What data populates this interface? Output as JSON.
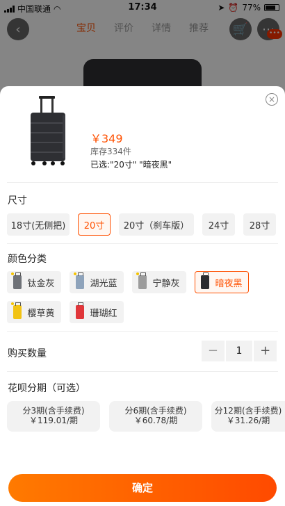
{
  "status": {
    "carrier": "中国联通",
    "time": "17:34",
    "battery": "77%",
    "battery_level": 0.77
  },
  "nav": {
    "tabs": [
      {
        "label": "宝贝",
        "active": true
      },
      {
        "label": "评价",
        "active": false
      },
      {
        "label": "详情",
        "active": false
      },
      {
        "label": "推荐",
        "active": false
      }
    ],
    "badge": "•••"
  },
  "product": {
    "price": "￥349",
    "stock": "库存334件",
    "selected": "已选:\"20寸\" \"暗夜黑\""
  },
  "size": {
    "title": "尺寸",
    "options": [
      "18寸(无侧把)",
      "20寸",
      "20寸（刹车版）",
      "24寸",
      "28寸"
    ],
    "selected": "20寸"
  },
  "color": {
    "title": "颜色分类",
    "options": [
      {
        "label": "钛金灰",
        "swatch": "#6f7278"
      },
      {
        "label": "湖光蓝",
        "swatch": "#8ea3bb"
      },
      {
        "label": "宁静灰",
        "swatch": "#9c9c9c"
      },
      {
        "label": "暗夜黑",
        "swatch": "#2b2c30"
      },
      {
        "label": "樱草黄",
        "swatch": "#f2c314"
      },
      {
        "label": "珊瑚红",
        "swatch": "#e0363a"
      }
    ],
    "selected": "暗夜黑"
  },
  "quantity": {
    "title": "购买数量",
    "minus": "−",
    "value": "1",
    "plus": "+"
  },
  "installment": {
    "title": "花呗分期（可选）",
    "plans": [
      {
        "title": "分3期(含手续费)",
        "amount": "￥119.01/期"
      },
      {
        "title": "分6期(含手续费)",
        "amount": "￥60.78/期"
      },
      {
        "title": "分12期(含手续费)",
        "amount": "￥31.26/期"
      }
    ]
  },
  "confirm_label": "确定",
  "colors": {
    "accent": "#ff5000",
    "chip_bg": "#f2f2f2"
  }
}
